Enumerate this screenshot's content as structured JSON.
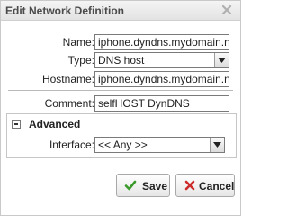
{
  "dialog": {
    "title": "Edit Network Definition",
    "close_icon": "close-x-icon"
  },
  "form": {
    "name_label": "Name:",
    "name_value": "iphone.dyndns.mydomain.ne",
    "type_label": "Type:",
    "type_value": "DNS host",
    "hostname_label": "Hostname:",
    "hostname_value": "iphone.dyndns.mydomain.ne",
    "comment_label": "Comment:",
    "comment_value": "selfHOST DynDNS"
  },
  "advanced": {
    "title": "Advanced",
    "toggle_icon": "collapse-minus-icon",
    "interface_label": "Interface:",
    "interface_value": "<< Any >>"
  },
  "buttons": {
    "save_label": "Save",
    "save_icon": "check-icon",
    "cancel_label": "Cancel",
    "cancel_icon": "x-icon"
  },
  "colors": {
    "save_check": "#3a9a2a",
    "cancel_x": "#cc2a2a",
    "title_text": "#4a4a4a"
  }
}
